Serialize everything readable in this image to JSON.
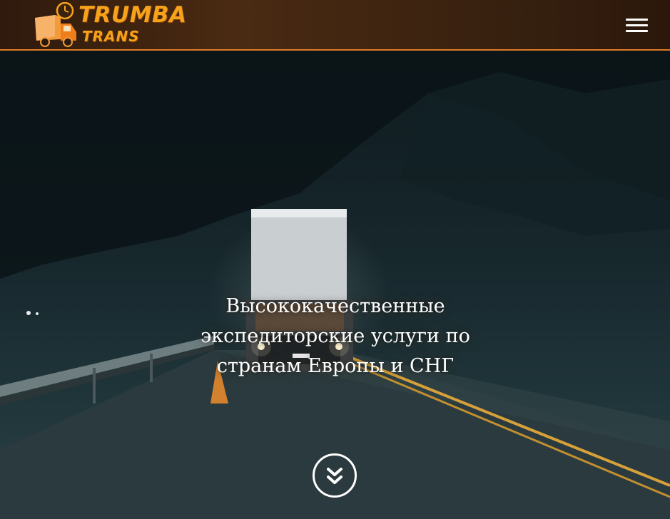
{
  "header": {
    "logo": {
      "line1": "TRUMBA",
      "line2": "TRANS",
      "icon": "truck-clock-icon"
    },
    "menu_icon": "hamburger-icon"
  },
  "hero": {
    "headline": "Высококачественные экспедиторские услуги по странам Европы и СНГ",
    "scroll_icon": "double-chevron-down-icon"
  },
  "colors": {
    "header_bg": "#3a2210",
    "accent": "#f7a21b",
    "border": "#e07a25",
    "text": "#ffffff"
  }
}
